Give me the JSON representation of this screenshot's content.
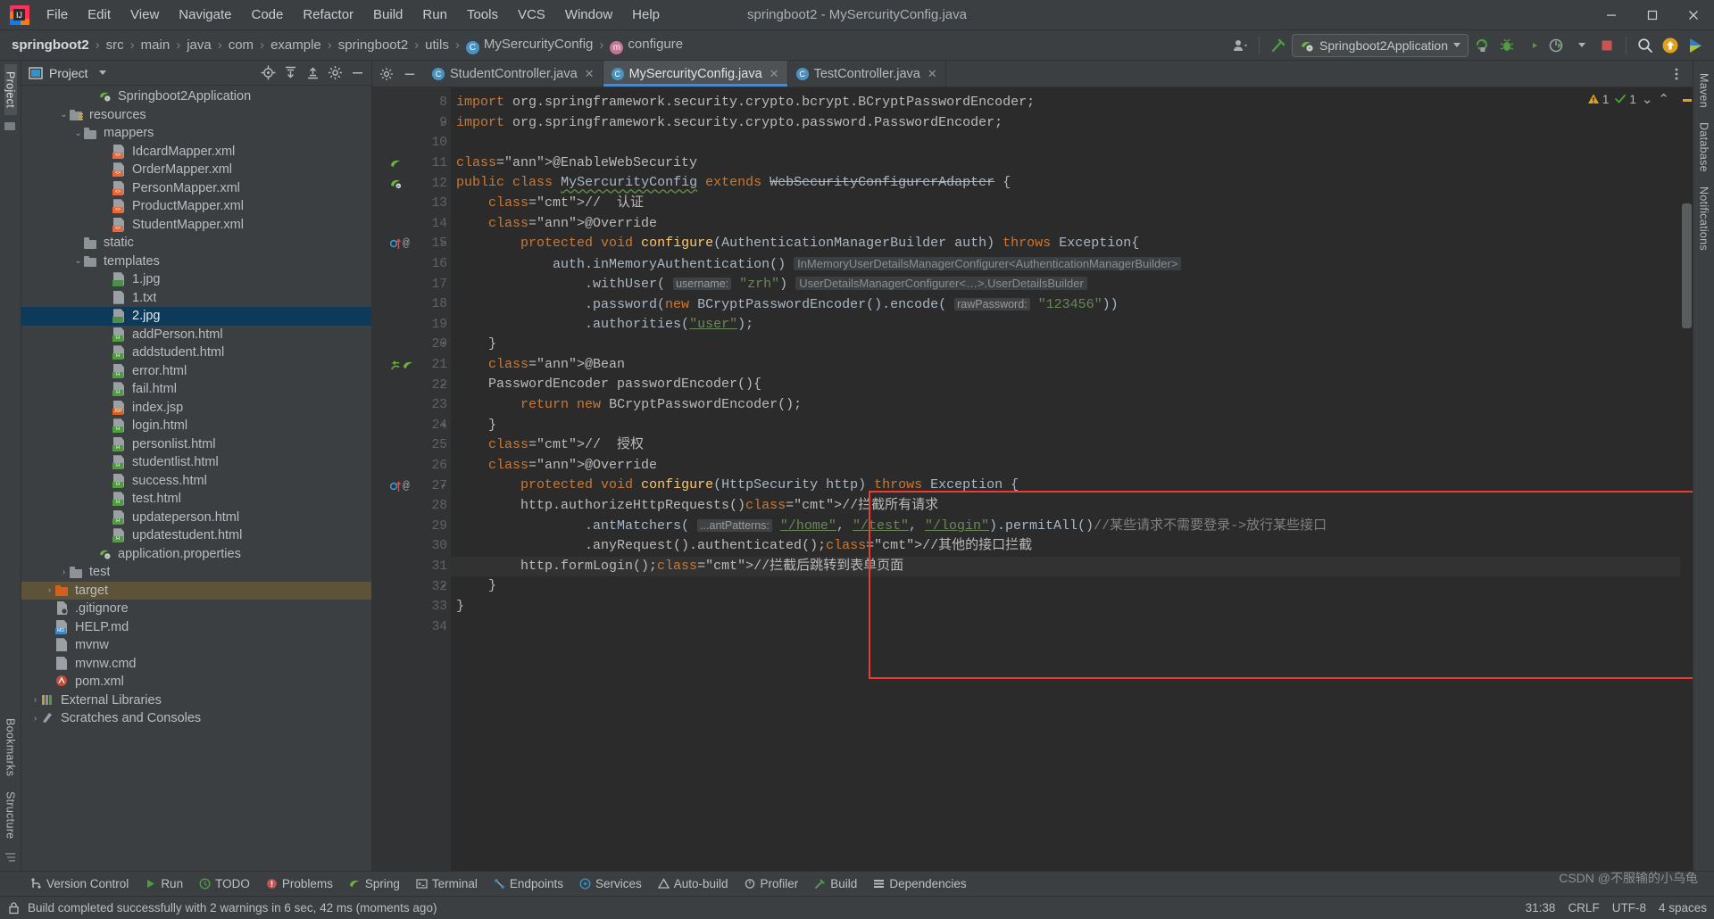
{
  "window": {
    "title": "springboot2 - MySercurityConfig.java",
    "minimize": "–",
    "maximize": "□",
    "close": "✕"
  },
  "menubar": {
    "items": [
      "File",
      "Edit",
      "View",
      "Navigate",
      "Code",
      "Refactor",
      "Build",
      "Run",
      "Tools",
      "VCS",
      "Window",
      "Help"
    ]
  },
  "breadcrumb": {
    "items": [
      {
        "label": "springboot2",
        "icon": "none"
      },
      {
        "label": "src",
        "icon": "none"
      },
      {
        "label": "main",
        "icon": "none"
      },
      {
        "label": "java",
        "icon": "none"
      },
      {
        "label": "com",
        "icon": "none"
      },
      {
        "label": "example",
        "icon": "none"
      },
      {
        "label": "springboot2",
        "icon": "none"
      },
      {
        "label": "utils",
        "icon": "none"
      },
      {
        "label": "MySercurityConfig",
        "icon": "class"
      },
      {
        "label": "configure",
        "icon": "method"
      }
    ],
    "separator": "›"
  },
  "toolbar": {
    "account_icon": "user-icon",
    "build_icon": "hammer-icon",
    "run_config": "Springboot2Application",
    "run_icon": "run-icon",
    "debug_icon": "debug-icon",
    "coverage_icon": "coverage-icon",
    "profiler_icon": "profiler-icon",
    "stop_icon": "stop-icon",
    "search_icon": "search-icon",
    "update_icon": "update-icon",
    "more_icon": "more-icon"
  },
  "project_pane": {
    "title": "Project",
    "collapse_label": "▾",
    "icons": [
      "locate-icon",
      "expand-all-icon",
      "collapse-all-icon",
      "settings-icon",
      "hide-icon"
    ],
    "tree": [
      {
        "label": "Springboot2Application",
        "indent": 5,
        "icon": "spring",
        "twist": "",
        "state": ""
      },
      {
        "label": "resources",
        "indent": 3,
        "icon": "folder-res",
        "twist": "⌄",
        "state": ""
      },
      {
        "label": "mappers",
        "indent": 4,
        "icon": "folder",
        "twist": "⌄",
        "state": ""
      },
      {
        "label": "IdcardMapper.xml",
        "indent": 6,
        "icon": "xml",
        "twist": "",
        "state": ""
      },
      {
        "label": "OrderMapper.xml",
        "indent": 6,
        "icon": "xml",
        "twist": "",
        "state": ""
      },
      {
        "label": "PersonMapper.xml",
        "indent": 6,
        "icon": "xml",
        "twist": "",
        "state": ""
      },
      {
        "label": "ProductMapper.xml",
        "indent": 6,
        "icon": "xml",
        "twist": "",
        "state": ""
      },
      {
        "label": "StudentMapper.xml",
        "indent": 6,
        "icon": "xml",
        "twist": "",
        "state": ""
      },
      {
        "label": "static",
        "indent": 4,
        "icon": "folder",
        "twist": "",
        "state": ""
      },
      {
        "label": "templates",
        "indent": 4,
        "icon": "folder",
        "twist": "⌄",
        "state": ""
      },
      {
        "label": "1.jpg",
        "indent": 6,
        "icon": "img",
        "twist": "",
        "state": ""
      },
      {
        "label": "1.txt",
        "indent": 6,
        "icon": "txt",
        "twist": "",
        "state": ""
      },
      {
        "label": "2.jpg",
        "indent": 6,
        "icon": "img",
        "twist": "",
        "state": "sel"
      },
      {
        "label": "addPerson.html",
        "indent": 6,
        "icon": "html",
        "twist": "",
        "state": ""
      },
      {
        "label": "addstudent.html",
        "indent": 6,
        "icon": "html",
        "twist": "",
        "state": ""
      },
      {
        "label": "error.html",
        "indent": 6,
        "icon": "html",
        "twist": "",
        "state": ""
      },
      {
        "label": "fail.html",
        "indent": 6,
        "icon": "html",
        "twist": "",
        "state": ""
      },
      {
        "label": "index.jsp",
        "indent": 6,
        "icon": "jsp",
        "twist": "",
        "state": ""
      },
      {
        "label": "login.html",
        "indent": 6,
        "icon": "html",
        "twist": "",
        "state": ""
      },
      {
        "label": "personlist.html",
        "indent": 6,
        "icon": "html",
        "twist": "",
        "state": ""
      },
      {
        "label": "studentlist.html",
        "indent": 6,
        "icon": "html",
        "twist": "",
        "state": ""
      },
      {
        "label": "success.html",
        "indent": 6,
        "icon": "html",
        "twist": "",
        "state": ""
      },
      {
        "label": "test.html",
        "indent": 6,
        "icon": "html",
        "twist": "",
        "state": ""
      },
      {
        "label": "updateperson.html",
        "indent": 6,
        "icon": "html",
        "twist": "",
        "state": ""
      },
      {
        "label": "updatestudent.html",
        "indent": 6,
        "icon": "html",
        "twist": "",
        "state": ""
      },
      {
        "label": "application.properties",
        "indent": 5,
        "icon": "spring",
        "twist": "",
        "state": ""
      },
      {
        "label": "test",
        "indent": 3,
        "icon": "folder",
        "twist": "›",
        "state": ""
      },
      {
        "label": "target",
        "indent": 2,
        "icon": "folder-orange",
        "twist": "›",
        "state": "sel-dim"
      },
      {
        "label": ".gitignore",
        "indent": 2,
        "icon": "git",
        "twist": "",
        "state": ""
      },
      {
        "label": "HELP.md",
        "indent": 2,
        "icon": "md",
        "twist": "",
        "state": ""
      },
      {
        "label": "mvnw",
        "indent": 2,
        "icon": "txt",
        "twist": "",
        "state": ""
      },
      {
        "label": "mvnw.cmd",
        "indent": 2,
        "icon": "txt",
        "twist": "",
        "state": ""
      },
      {
        "label": "pom.xml",
        "indent": 2,
        "icon": "maven",
        "twist": "",
        "state": ""
      },
      {
        "label": "External Libraries",
        "indent": 1,
        "icon": "libs",
        "twist": "›",
        "state": ""
      },
      {
        "label": "Scratches and Consoles",
        "indent": 1,
        "icon": "scratch",
        "twist": "›",
        "state": ""
      }
    ]
  },
  "left_rail": {
    "items": [
      "Project",
      "Bookmarks",
      "Structure"
    ]
  },
  "right_rail": {
    "items": [
      "Maven",
      "Database",
      "Notifications"
    ]
  },
  "editor": {
    "tabs": [
      {
        "label": "StudentController.java",
        "active": false,
        "close": "✕"
      },
      {
        "label": "MySercurityConfig.java",
        "active": true,
        "close": "✕"
      },
      {
        "label": "TestController.java",
        "active": false,
        "close": "✕"
      }
    ],
    "inspection": {
      "warning_icon": "warning-triangle-icon",
      "warning_count": "1",
      "check_icon": "checkmark-icon",
      "check_count": "1",
      "chevron_down": "⌄",
      "chevron_up": "⌃"
    },
    "first_line_number": 8,
    "current_line": 31,
    "lines": [
      {
        "n": 8,
        "gutter": []
      },
      {
        "n": 9,
        "gutter": [],
        "fold": "⊖"
      },
      {
        "n": 10,
        "gutter": []
      },
      {
        "n": 11,
        "gutter": [
          "spring-leaf"
        ]
      },
      {
        "n": 12,
        "gutter": [
          "spring-bean"
        ]
      },
      {
        "n": 13,
        "gutter": []
      },
      {
        "n": 14,
        "gutter": []
      },
      {
        "n": 15,
        "gutter": [
          "override-up",
          "at"
        ],
        "fold": "⊖"
      },
      {
        "n": 16,
        "gutter": []
      },
      {
        "n": 17,
        "gutter": []
      },
      {
        "n": 18,
        "gutter": []
      },
      {
        "n": 19,
        "gutter": []
      },
      {
        "n": 20,
        "gutter": [],
        "fold": "⊕"
      },
      {
        "n": 21,
        "gutter": [
          "bean-arrow",
          "spring-leaf"
        ]
      },
      {
        "n": 22,
        "gutter": [],
        "fold": "⊖"
      },
      {
        "n": 23,
        "gutter": []
      },
      {
        "n": 24,
        "gutter": [],
        "fold": "⊕"
      },
      {
        "n": 25,
        "gutter": []
      },
      {
        "n": 26,
        "gutter": []
      },
      {
        "n": 27,
        "gutter": [
          "override-up",
          "at"
        ],
        "fold": "⊖"
      },
      {
        "n": 28,
        "gutter": []
      },
      {
        "n": 29,
        "gutter": []
      },
      {
        "n": 30,
        "gutter": []
      },
      {
        "n": 31,
        "gutter": []
      },
      {
        "n": 32,
        "gutter": [],
        "fold": "⊕"
      },
      {
        "n": 33,
        "gutter": []
      },
      {
        "n": 34,
        "gutter": []
      }
    ],
    "code_text": [
      "import org.springframework.security.crypto.bcrypt.BCryptPasswordEncoder;",
      "import org.springframework.security.crypto.password.PasswordEncoder;",
      "",
      "@EnableWebSecurity",
      "public class MySercurityConfig extends WebSecurityConfigurerAdapter {",
      "    //  认证",
      "    @Override",
      "    protected void configure(AuthenticationManagerBuilder auth) throws Exception{",
      "        auth.inMemoryAuthentication()  InMemoryUserDetailsManagerConfigurer<AuthenticationManagerBuilder>",
      "                .withUser( username: \"zrh\")  UserDetailsManagerConfigurer<...>.UserDetailsBuilder",
      "                .password(new BCryptPasswordEncoder().encode( rawPassword: \"123456\"))",
      "                .authorities(\"user\");",
      "    }",
      "    @Bean",
      "    PasswordEncoder passwordEncoder(){",
      "        return new BCryptPasswordEncoder();",
      "    }",
      "    //  授权",
      "    @Override",
      "    protected void configure(HttpSecurity http) throws Exception {",
      "        http.authorizeHttpRequests()//拦截所有请求",
      "                .antMatchers( ...antPatterns: \"/home\", \"/test\", \"/login\").permitAll()//某些请求不需要登录->放行某些接口",
      "                .anyRequest().authenticated();//其他的接口拦截",
      "        http.formLogin();//拦截后跳转到表单页面",
      "    }",
      "}",
      ""
    ],
    "highlight_box": {
      "color": "#f03a2e",
      "label": "authorization-config-highlight"
    }
  },
  "bottom_bar": {
    "items": [
      {
        "label": "Version Control",
        "icon": "branch-icon"
      },
      {
        "label": "Run",
        "icon": "run-icon"
      },
      {
        "label": "TODO",
        "icon": "todo-icon"
      },
      {
        "label": "Problems",
        "icon": "problems-icon"
      },
      {
        "label": "Spring",
        "icon": "spring-icon"
      },
      {
        "label": "Terminal",
        "icon": "terminal-icon"
      },
      {
        "label": "Endpoints",
        "icon": "endpoints-icon"
      },
      {
        "label": "Services",
        "icon": "services-icon"
      },
      {
        "label": "Auto-build",
        "icon": "autobuild-icon"
      },
      {
        "label": "Profiler",
        "icon": "profiler-icon"
      },
      {
        "label": "Build",
        "icon": "build-icon"
      },
      {
        "label": "Dependencies",
        "icon": "dependencies-icon"
      }
    ]
  },
  "statusbar": {
    "message": "Build completed successfully with 2 warnings in 6 sec, 42 ms (moments ago)",
    "caret": "31:38",
    "line_sep": "CRLF",
    "encoding": "UTF-8",
    "indent": "4 spaces",
    "lock_icon": "lock-icon",
    "watermark": "CSDN @不服输的小乌龟"
  },
  "colors": {
    "accent": "#4a88c7",
    "highlight_red": "#f03a2e",
    "selection_blue": "#0d3a58",
    "selection_dim": "#5c5338",
    "editor_bg": "#2b2b2b",
    "chrome_bg": "#3c3f41"
  }
}
